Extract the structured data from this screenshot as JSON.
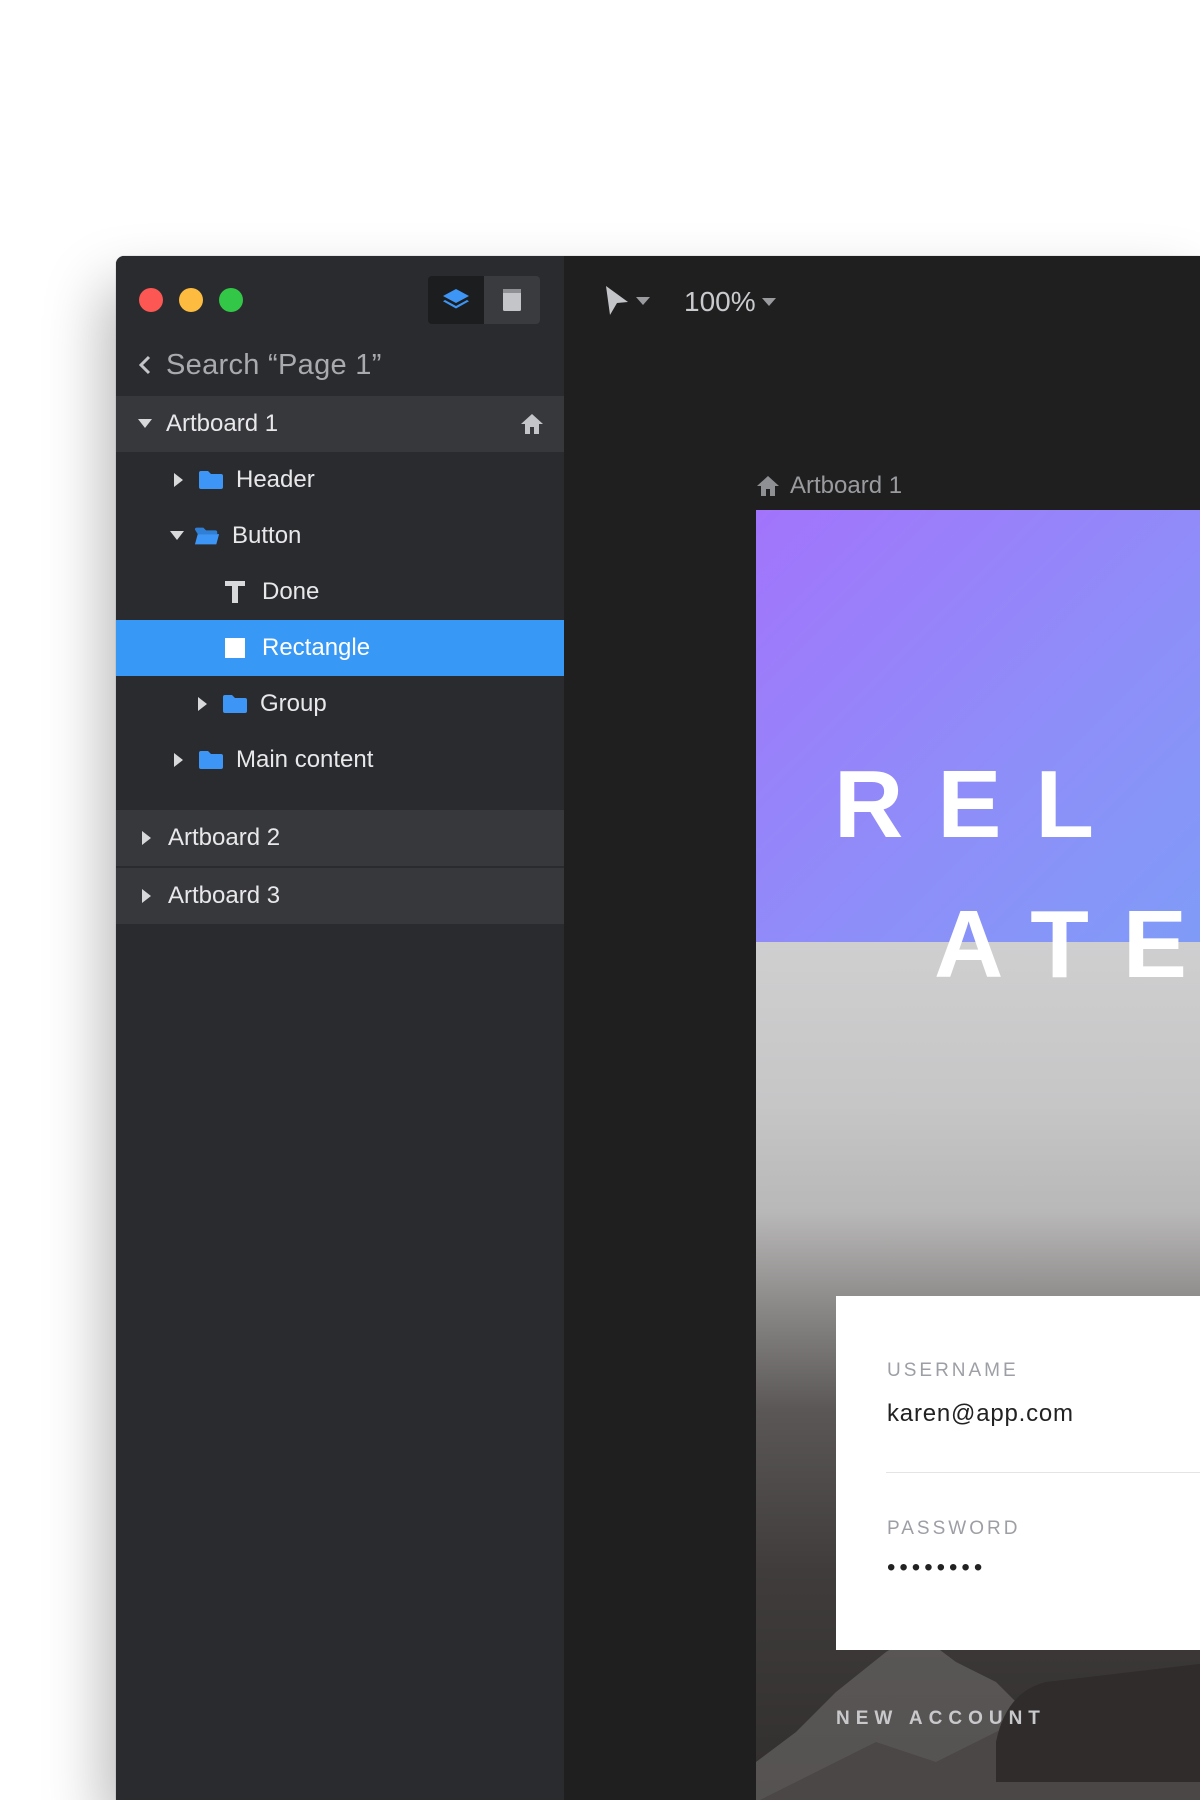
{
  "sidebar": {
    "search_text": "Search “Page 1”",
    "view_switch": [
      "layers-icon",
      "page-icon"
    ],
    "artboards": [
      {
        "label": "Artboard 1",
        "expanded": true
      },
      {
        "label": "Artboard 2",
        "expanded": false
      },
      {
        "label": "Artboard 3",
        "expanded": false
      }
    ],
    "layers": [
      {
        "label": "Header",
        "type": "folder",
        "expanded": false
      },
      {
        "label": "Button",
        "type": "folder",
        "expanded": true
      },
      {
        "label": "Done",
        "type": "text"
      },
      {
        "label": "Rectangle",
        "type": "shape",
        "selected": true
      },
      {
        "label": "Group",
        "type": "folder",
        "expanded": false
      },
      {
        "label": "Main content",
        "type": "folder",
        "expanded": false
      }
    ]
  },
  "toolbar": {
    "zoom": "100%"
  },
  "canvas": {
    "artboard_caption": "Artboard 1",
    "hero_line1": "REL",
    "hero_line2": "ATE",
    "username_label": "USERNAME",
    "username_value": "karen@app.com",
    "password_label": "PASSWORD",
    "password_value": "••••••••",
    "new_account": "NEW ACCOUNT"
  },
  "colors": {
    "selection": "#3898f6",
    "folder": "#3d96f5",
    "gradient_start": "#a274fb",
    "gradient_end": "#7f9cf7"
  }
}
